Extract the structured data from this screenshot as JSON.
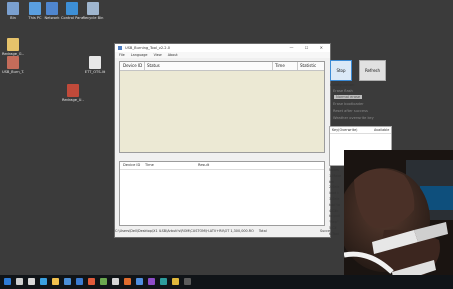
{
  "desktop": {
    "icons": [
      {
        "label": "Bin",
        "color": "#7aa0d0"
      },
      {
        "label": "This PC",
        "color": "#5a9fe0"
      },
      {
        "label": "Network",
        "color": "#4f86cf"
      },
      {
        "label": "Control Panel",
        "color": "#3d8fd6"
      },
      {
        "label": "Recycle Bin",
        "color": "#9fb6cf"
      },
      {
        "label": "Redrage_G...",
        "color": "#e6c36b"
      },
      {
        "label": "USB_Burn_T...",
        "color": "#c46c5a"
      },
      {
        "label": "ETT_OTS-lit",
        "color": "#e7e7e7"
      },
      {
        "label": "Redrage_U...",
        "color": "#c04a3a"
      }
    ]
  },
  "window": {
    "title": "USB_Burning_Tool_v2.2.0",
    "menu": [
      "File",
      "Language",
      "View",
      "About"
    ],
    "top_grid_headers": [
      "Device ID",
      "Status",
      "Time",
      "Statistic"
    ],
    "bottom_grid_headers": [
      "Device ID",
      "Time",
      "Result"
    ],
    "status_path": "C:\\Users\\Dell\\Desktop\\X1 ILSB\\Arbuti's\\ROM\\CUSTOM\\H.ATV+RII\\OT 1,300,000.RO",
    "status_total": "Total",
    "status_success": "Success"
  },
  "controls": {
    "stop_label": "Stop",
    "refresh_label": "Refresh",
    "configuration_label": "Configuration",
    "erase_flash": "Erase flash",
    "normal_erase": "Normal erase",
    "erase_bootloader": "Erase bootloader",
    "reset_after_success": "Reset after success",
    "overwrite_keys": "Weather overwrite key",
    "key_col": "Key(Overwrite)",
    "available_col": "Available",
    "notes_label": "Notes"
  },
  "notes_items": [
    "1.Make",
    "bin",
    "2.Sele",
    "load t",
    "3.Sele",
    "tool to",
    "4.Clic",
    "to pull",
    "\"Rep\"",
    "5.Cli",
    "6.Tool"
  ],
  "taskbar": {
    "items": [
      {
        "name": "start",
        "color": "#2d7bd6"
      },
      {
        "name": "search",
        "color": "#cfcfcf"
      },
      {
        "name": "task-view",
        "color": "#d8d8d8"
      },
      {
        "name": "edge",
        "color": "#3aa0e0"
      },
      {
        "name": "explorer",
        "color": "#f2c14e"
      },
      {
        "name": "store",
        "color": "#4a8fd8"
      },
      {
        "name": "mail",
        "color": "#3b7bd1"
      },
      {
        "name": "app-1",
        "color": "#e05b3b"
      },
      {
        "name": "app-2",
        "color": "#6aa84f"
      },
      {
        "name": "app-3",
        "color": "#d6d6d6"
      },
      {
        "name": "app-4",
        "color": "#e06c2e"
      },
      {
        "name": "app-5",
        "color": "#4f8fe0"
      },
      {
        "name": "app-6",
        "color": "#8e4cc8"
      },
      {
        "name": "app-7",
        "color": "#2c9c9c"
      },
      {
        "name": "app-8",
        "color": "#e0b83b"
      },
      {
        "name": "app-9",
        "color": "#5b5b5b"
      }
    ]
  }
}
